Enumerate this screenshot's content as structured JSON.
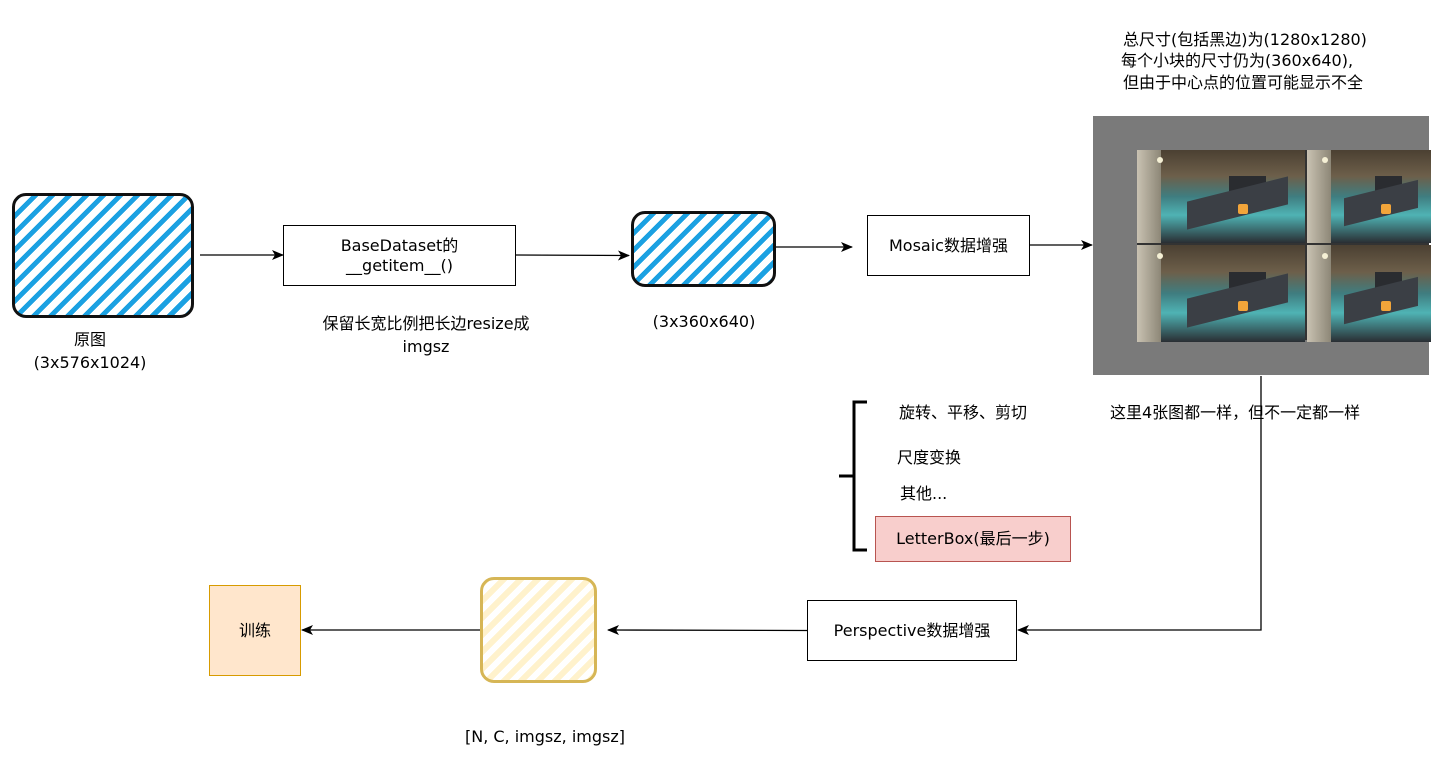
{
  "original": {
    "title": "原图",
    "shape": "(3x576x1024)"
  },
  "dataset_box": {
    "line1": "BaseDataset的",
    "line2": "__getitem__()"
  },
  "resize_note": {
    "line1": "保留长宽比例把长边resize成",
    "line2": "imgsz"
  },
  "resized_shape": "(3x360x640)",
  "mosaic_box": "Mosaic数据增强",
  "mosaic_note": {
    "line1": "总尺寸(包括黑边)为(1280x1280)",
    "line2": "每个小块的尺寸仍为(360x640),",
    "line3": "但由于中心点的位置可能显示不全"
  },
  "same_images_note": "这里4张图都一样，但不一定都一样",
  "augment_list": {
    "item1": "旋转、平移、剪切",
    "item2": "尺度变换",
    "item3": "其他...",
    "item4": "LetterBox(最后一步)"
  },
  "perspective_box": "Perspective数据增强",
  "output_shape": "[N, C, imgsz, imgsz]",
  "train_box": "训练",
  "colors": {
    "hatch_blue": "#1ba1e2",
    "letterbox_fill": "#f8cecc",
    "letterbox_border": "#b85450",
    "train_fill": "#ffe6cc",
    "train_border": "#d79b00",
    "output_fill": "#fff2cc",
    "output_border": "#d6b656",
    "mosaic_bg": "#7a7a7a"
  }
}
